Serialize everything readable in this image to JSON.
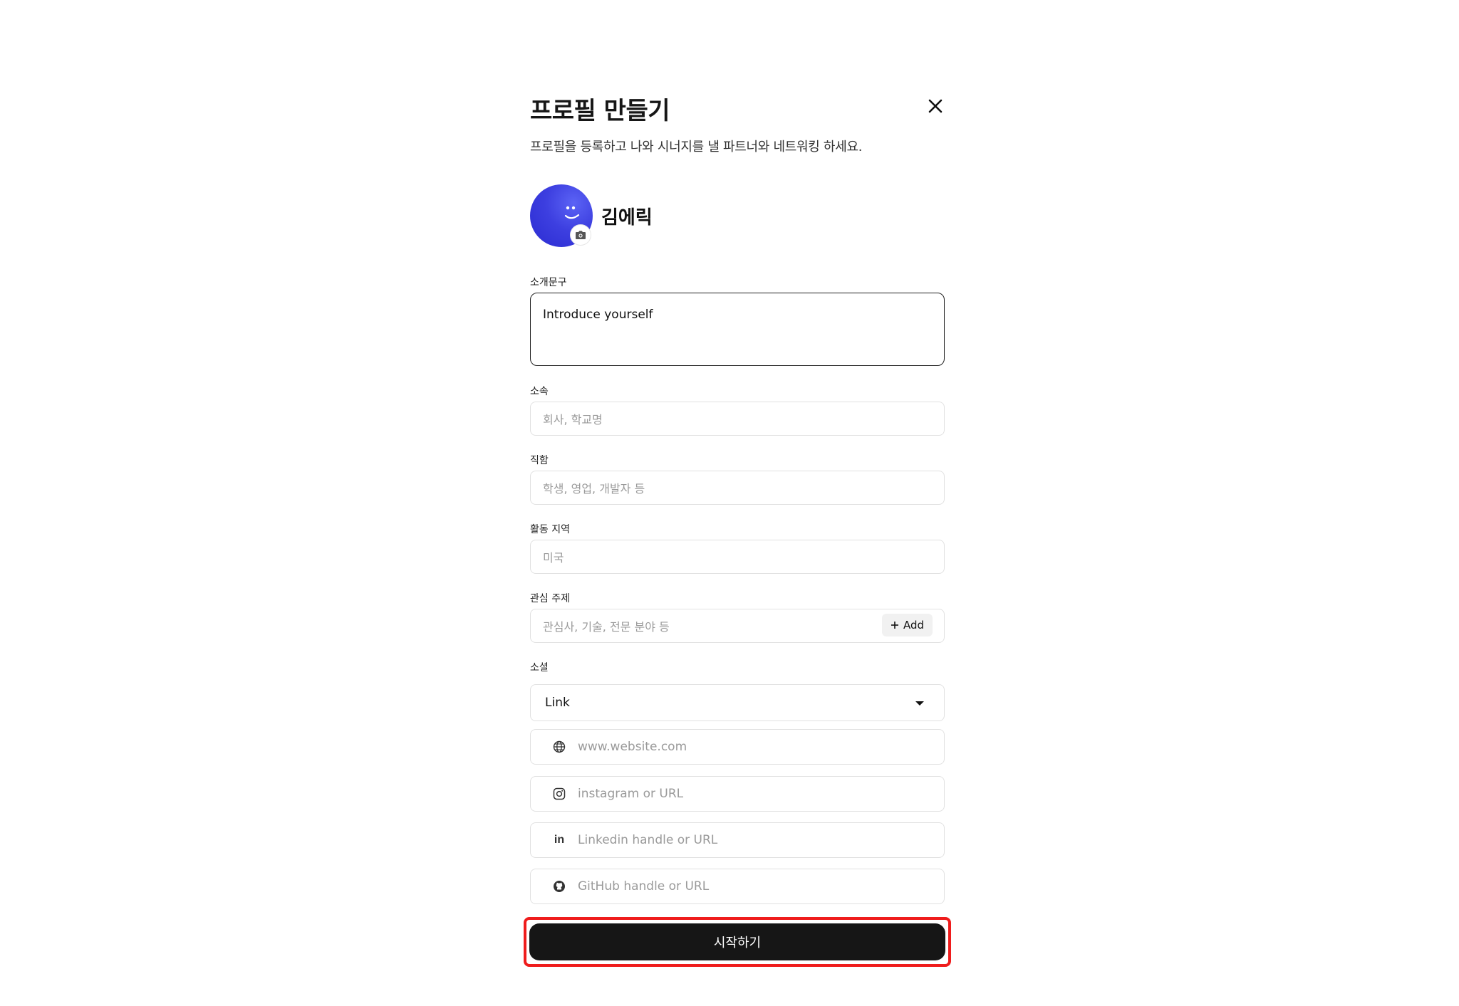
{
  "dialog": {
    "title": "프로필 만들기",
    "subtitle": "프로필을 등록하고 나와 시너지를 낼 파트너와 네트워킹 하세요."
  },
  "profile": {
    "name": "김에릭"
  },
  "intro": {
    "label": "소개문구",
    "value": "Introduce yourself"
  },
  "affiliation": {
    "label": "소속",
    "placeholder": "회사, 학교명"
  },
  "job_title": {
    "label": "직함",
    "placeholder": "학생, 영업, 개발자 등"
  },
  "region": {
    "label": "활동 지역",
    "placeholder": "미국"
  },
  "interests": {
    "label": "관심 주제",
    "placeholder": "관심사, 기술, 전문 분야 등",
    "add_label": "Add"
  },
  "social": {
    "label": "소셜",
    "select_value": "Link",
    "items": [
      {
        "icon": "globe-icon",
        "placeholder": "www.website.com"
      },
      {
        "icon": "instagram-icon",
        "placeholder": "instagram or URL"
      },
      {
        "icon": "linkedin-icon",
        "placeholder": "Linkedin handle or URL"
      },
      {
        "icon": "github-icon",
        "placeholder": "GitHub handle or URL"
      }
    ]
  },
  "submit": {
    "label": "시작하기"
  },
  "colors": {
    "accent": "#161616",
    "avatar": "#3d3fe0",
    "highlight": "#ef1c1c"
  }
}
